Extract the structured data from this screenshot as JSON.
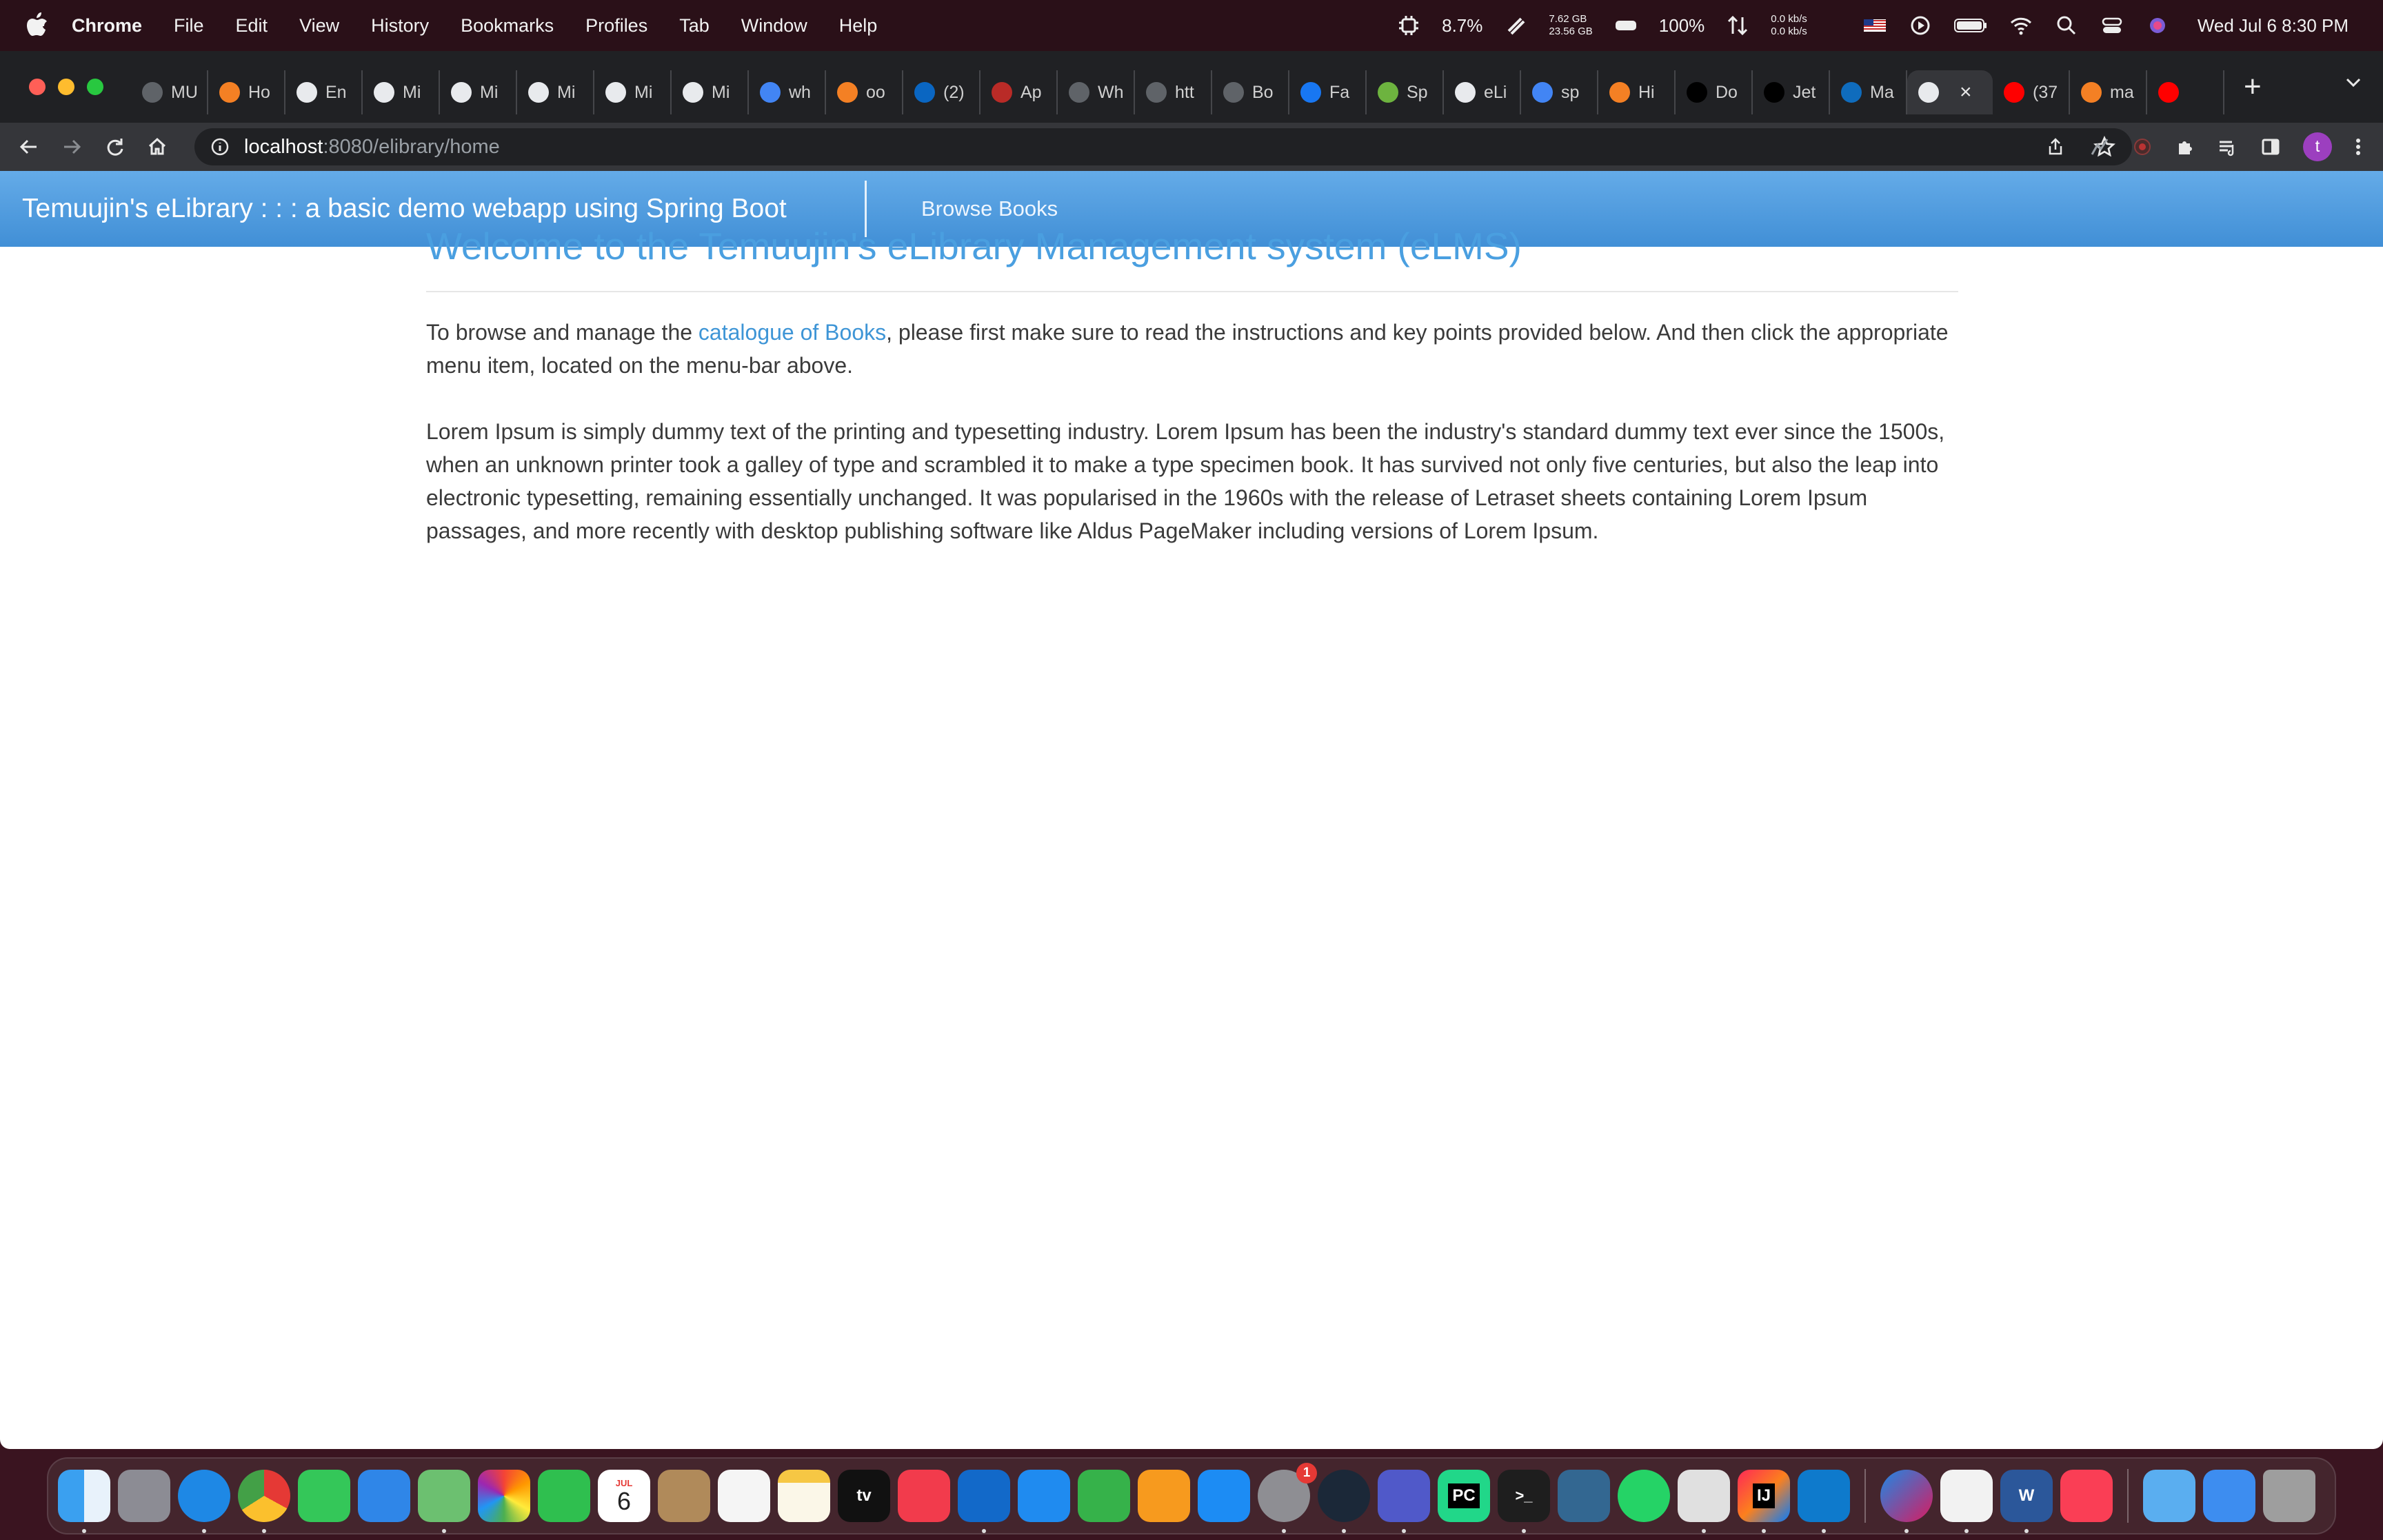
{
  "menubar": {
    "app_name": "Chrome",
    "items": [
      "File",
      "Edit",
      "View",
      "History",
      "Bookmarks",
      "Profiles",
      "Tab",
      "Window",
      "Help"
    ],
    "status": {
      "cpu": "8.7%",
      "memory_used": "7.62 GB",
      "memory_total": "23.56 GB",
      "battery": "100%",
      "net_up": "0.0 kb/s",
      "net_down": "0.0 kb/s",
      "datetime": "Wed Jul 6  8:30 PM"
    }
  },
  "browser": {
    "tabs": [
      {
        "label": "MU",
        "icon": "fav-generic"
      },
      {
        "label": "Ho",
        "icon": "fav-stackoverflow"
      },
      {
        "label": "En",
        "icon": "fav-globe"
      },
      {
        "label": "Mi",
        "icon": "fav-globe"
      },
      {
        "label": "Mi",
        "icon": "fav-globe"
      },
      {
        "label": "Mi",
        "icon": "fav-globe"
      },
      {
        "label": "Mi",
        "icon": "fav-globe"
      },
      {
        "label": "Mi",
        "icon": "fav-globe"
      },
      {
        "label": "wh",
        "icon": "fav-google"
      },
      {
        "label": "oo",
        "icon": "fav-stackoverflow"
      },
      {
        "label": "(2)",
        "icon": "fav-linkedin"
      },
      {
        "label": "Ap",
        "icon": "fav-quora"
      },
      {
        "label": "Wh",
        "icon": "fav-generic"
      },
      {
        "label": "htt",
        "icon": "fav-generic"
      },
      {
        "label": "Bo",
        "icon": "fav-generic"
      },
      {
        "label": "Fa",
        "icon": "fav-facebook"
      },
      {
        "label": "Sp",
        "icon": "fav-spring"
      },
      {
        "label": "eLi",
        "icon": "fav-globe"
      },
      {
        "label": "sp",
        "icon": "fav-google"
      },
      {
        "label": "Hi",
        "icon": "fav-stackoverflow"
      },
      {
        "label": "Do",
        "icon": "fav-jetbrains"
      },
      {
        "label": "Jet",
        "icon": "fav-jetbrains"
      },
      {
        "label": "Ma",
        "icon": "fav-outlook"
      },
      {
        "label": "",
        "icon": "fav-globe",
        "active": true
      },
      {
        "label": "(37",
        "icon": "fav-youtube"
      },
      {
        "label": "ma",
        "icon": "fav-stackoverflow"
      },
      {
        "label": "",
        "icon": "fav-youtube"
      }
    ],
    "url_host": "localhost",
    "url_path": ":8080/elibrary/home",
    "profile_initial": "t"
  },
  "page": {
    "brand": "Temuujin's eLibrary : : : a basic demo webapp using Spring Boot",
    "nav_link": "Browse Books",
    "heading": "Welcome to the Temuujin's eLibrary Management system (eLMS)",
    "intro_before": "To browse and manage the ",
    "intro_link": "catalogue of Books",
    "intro_after": ", please first make sure to read the instructions and key points provided below. And then click the appropriate menu item, located on the menu-bar above.",
    "lorem": "Lorem Ipsum is simply dummy text of the printing and typesetting industry. Lorem Ipsum has been the industry's standard dummy text ever since the 1500s, when an unknown printer took a galley of type and scrambled it to make a type specimen book. It has survived not only five centuries, but also the leap into electronic typesetting, remaining essentially unchanged. It was popularised in the 1960s with the release of Letraset sheets containing Lorem Ipsum passages, and more recently with desktop publishing software like Aldus PageMaker including versions of Lorem Ipsum."
  },
  "dock": {
    "calendar_month": "JUL",
    "calendar_day": "6",
    "tv_label": "tv",
    "settings_badge": "1",
    "pycharm_label": "PC",
    "intellij_label": "IJ",
    "word_label": "W",
    "terminal_label": ">_"
  }
}
